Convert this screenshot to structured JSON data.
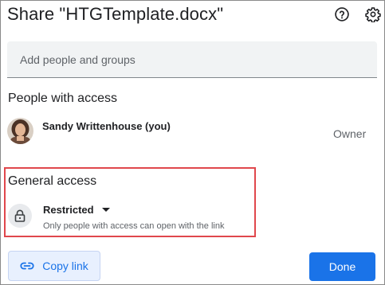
{
  "dialog": {
    "title": "Share \"HTGTemplate.docx\"",
    "help_icon": "help-circle-icon",
    "settings_icon": "gear-icon"
  },
  "add_people": {
    "placeholder": "Add people and groups",
    "value": ""
  },
  "people_with_access": {
    "heading": "People with access",
    "people": [
      {
        "name": "Sandy Writtenhouse (you)",
        "role": "Owner",
        "avatar_icon": "user-photo-avatar"
      }
    ]
  },
  "general_access": {
    "heading": "General access",
    "lock_icon": "lock-icon",
    "selected": "Restricted",
    "description": "Only people with access can open with the link",
    "highlight_color": "#e0474c"
  },
  "actions": {
    "copy_link_label": "Copy link",
    "copy_link_icon": "link-icon",
    "done_label": "Done"
  },
  "colors": {
    "accent": "#1a73e8",
    "copy_link_bg": "#e8f0fe",
    "field_bg": "#f1f3f4"
  }
}
